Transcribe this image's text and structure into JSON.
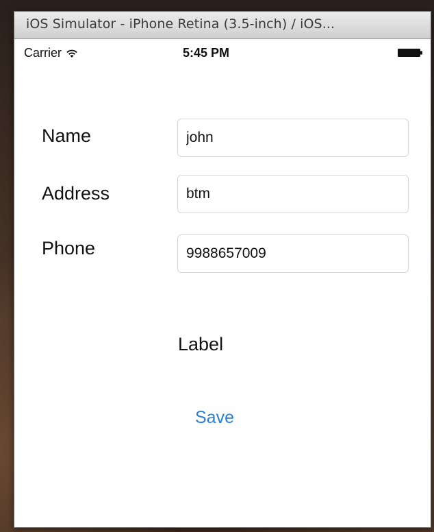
{
  "window": {
    "title": "iOS Simulator - iPhone Retina (3.5-inch) / iOS..."
  },
  "status_bar": {
    "carrier": "Carrier",
    "time": "5:45 PM",
    "icons": [
      "wifi-icon",
      "battery-icon"
    ]
  },
  "form": {
    "name_label": "Name",
    "name_value": "john",
    "address_label": "Address",
    "address_value": "btm",
    "phone_label": "Phone",
    "phone_value": "9988657009"
  },
  "output_label": "Label",
  "save_label": "Save",
  "colors": {
    "accent": "#2a7fd4",
    "field_border": "#d6d6d6"
  }
}
